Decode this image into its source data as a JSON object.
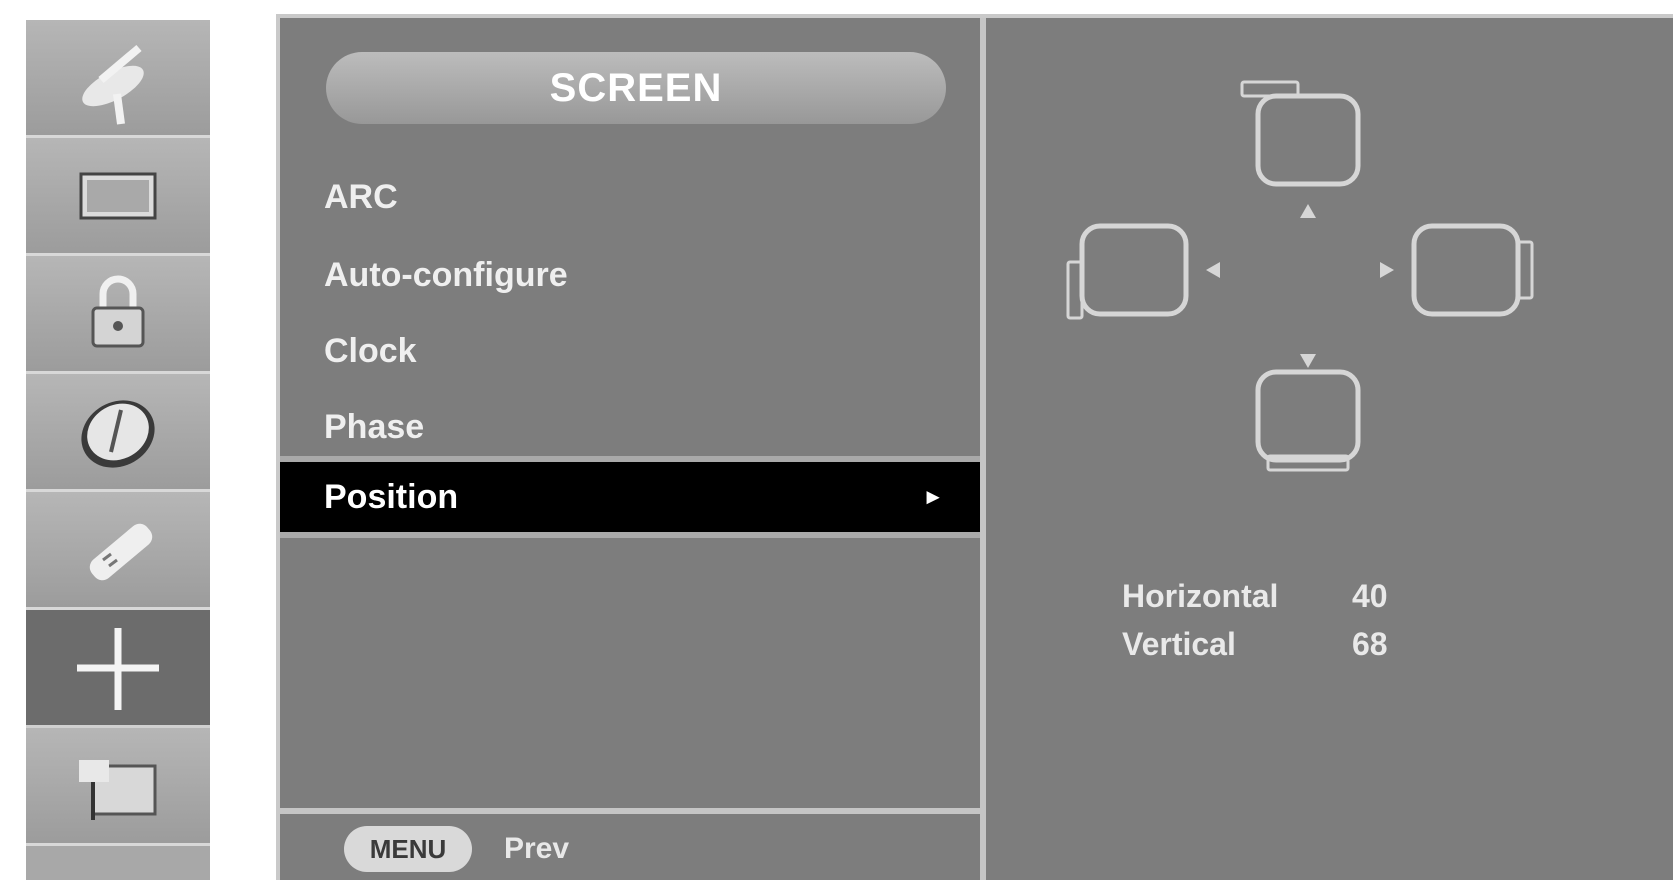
{
  "sidebar": {
    "items": [
      {
        "icon": "satellite-icon"
      },
      {
        "icon": "picture-icon"
      },
      {
        "icon": "lock-icon"
      },
      {
        "icon": "clock-icon"
      },
      {
        "icon": "option-icon"
      },
      {
        "icon": "screen-position-icon",
        "active": true
      },
      {
        "icon": "pip-icon"
      }
    ]
  },
  "menu": {
    "title": "SCREEN",
    "items": [
      "ARC",
      "Auto-configure",
      "Clock",
      "Phase",
      "Position"
    ],
    "selected": "Position",
    "selected_arrow": "►"
  },
  "footer": {
    "key_label": "MENU",
    "action_label": "Prev"
  },
  "position": {
    "horizontal_label": "Horizontal",
    "horizontal_value": "40",
    "vertical_label": "Vertical",
    "vertical_value": "68"
  },
  "colors": {
    "panel": "#7d7d7d",
    "selected_bar": "#000000",
    "active_sidebar": "#6c6c6c"
  }
}
